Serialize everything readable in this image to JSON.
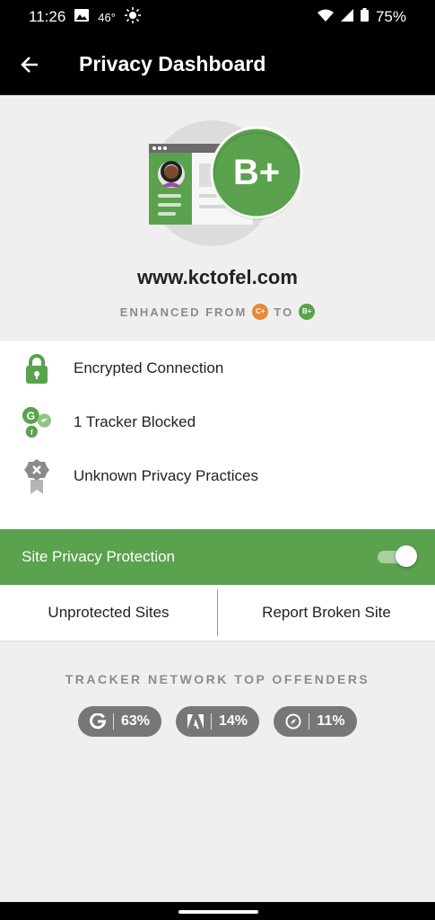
{
  "status_bar": {
    "time": "11:26",
    "temperature": "46°",
    "battery": "75%"
  },
  "app_bar": {
    "title": "Privacy Dashboard"
  },
  "hero": {
    "grade": "B+",
    "site": "www.kctofel.com",
    "enhanced_prefix": "ENHANCED FROM",
    "from_grade": "C+",
    "to_word": "TO",
    "to_grade": "B+",
    "colors": {
      "from_grade": "#e5883a",
      "to_grade": "#5aa24e"
    }
  },
  "items": [
    {
      "label": "Encrypted Connection",
      "icon": "lock-icon"
    },
    {
      "label": "1 Tracker Blocked",
      "icon": "tracker-networks-icon"
    },
    {
      "label": "Unknown Privacy Practices",
      "icon": "privacy-practices-icon"
    }
  ],
  "protection": {
    "label": "Site Privacy Protection",
    "enabled": true
  },
  "actions": {
    "unprotected": "Unprotected Sites",
    "report": "Report Broken Site"
  },
  "offenders": {
    "heading": "TRACKER NETWORK TOP OFFENDERS",
    "networks": [
      {
        "icon": "google-icon",
        "percent": "63%"
      },
      {
        "icon": "adobe-icon",
        "percent": "14%"
      },
      {
        "icon": "compass-network-icon",
        "percent": "11%"
      }
    ]
  },
  "accent": "#5aa24e"
}
